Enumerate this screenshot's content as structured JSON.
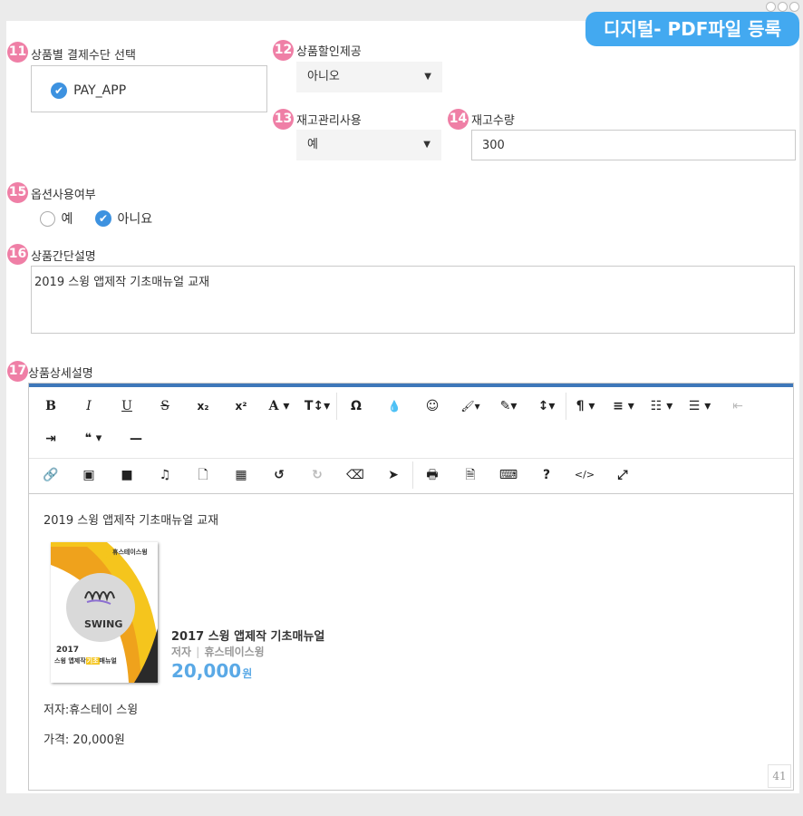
{
  "header": {
    "title": "디지털- PDF파일 등록"
  },
  "sections": {
    "payment": {
      "num": "11",
      "label": "상품별 결제수단 선택",
      "option": "PAY_APP"
    },
    "discount": {
      "num": "12",
      "label": "상품할인제공",
      "value": "아니오"
    },
    "inventory": {
      "num": "13",
      "label": "재고관리사용",
      "value": "예"
    },
    "stock": {
      "num": "14",
      "label": "재고수량",
      "value": "300"
    },
    "option_use": {
      "num": "15",
      "label": "옵션사용여부",
      "yes": "예",
      "no": "아니요"
    },
    "short_desc": {
      "num": "16",
      "label": "상품간단설명",
      "value": "2019 스윙 앱제작 기초매뉴얼 교재"
    },
    "detail": {
      "num": "17",
      "label": "상품상세설명"
    }
  },
  "editor": {
    "toolbar_row1": [
      "B",
      "I",
      "U",
      "S",
      "x₂",
      "x²",
      "A ▾",
      "T↕▾",
      "Ω",
      "💧",
      "☺",
      "🖌▾",
      "✎▾",
      "↕▾",
      "¶ ▾",
      "≡ ▾",
      "☷ ▾",
      "☰ ▾",
      "⇤"
    ],
    "toolbar_row1b": [
      "⇥",
      "❝ ▾",
      "—"
    ],
    "toolbar_row3": [
      "🔗",
      "▣",
      "■",
      "♫",
      "🗋",
      "▦",
      "↺",
      "↻",
      "⌫",
      "➤",
      "🖶",
      "🗎",
      "⌨",
      "?",
      "</>",
      "⤢"
    ],
    "content": {
      "line1": "2019 스윙 앱제작 기초매뉴얼 교재",
      "product_title": "2017 스윙 앱제작 기초매뉴얼",
      "author_label": "저자",
      "author_name": "휴스테이스윙",
      "price": "20,000",
      "price_unit": "원",
      "author_line": "저자:휴스테이 스윙",
      "price_line": "가격: 20,000원",
      "book_cover": {
        "brand": "휴스테이스윙",
        "logo_text": "SWING",
        "year": "2017",
        "title_a": "스윙 앱제작",
        "title_hl": "기초",
        "title_b": "매뉴얼"
      }
    },
    "counter": "41"
  }
}
